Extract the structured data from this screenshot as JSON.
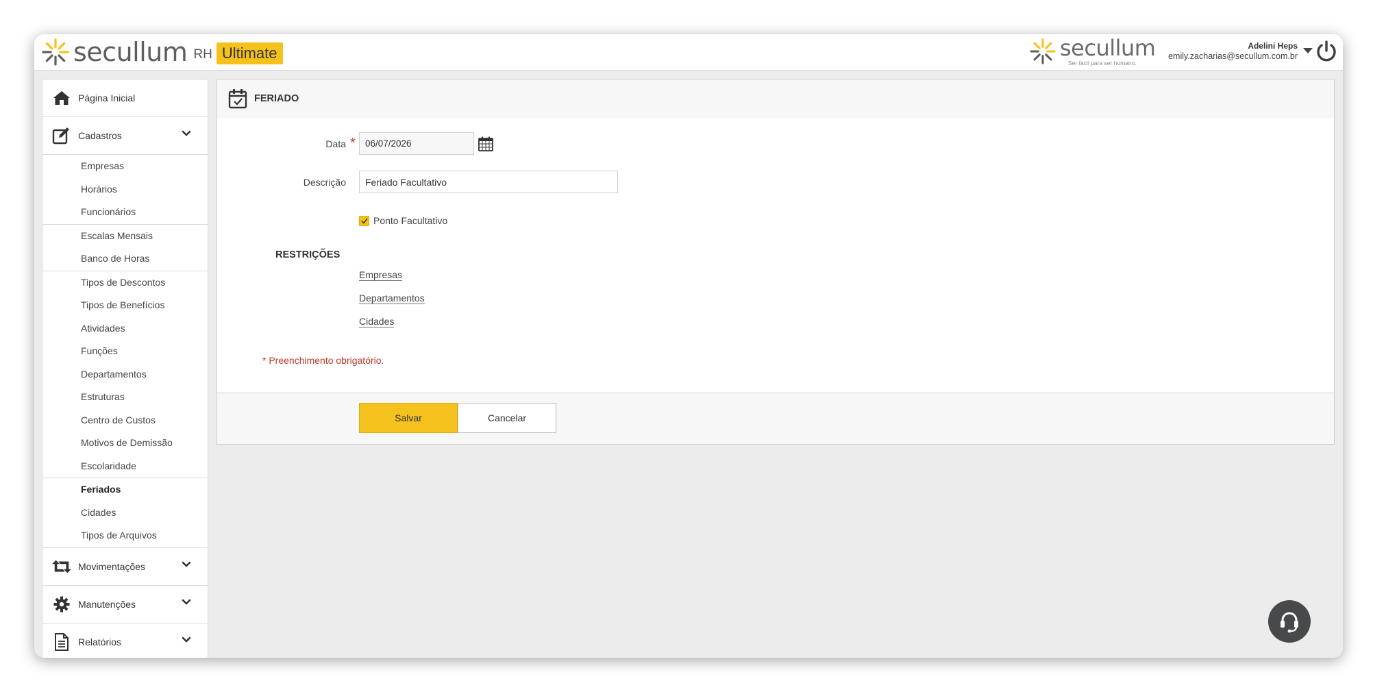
{
  "header": {
    "logo_word": "secullum",
    "logo_rh": "RH",
    "logo_badge": "Ultimate",
    "brand_word": "secullum",
    "brand_tagline": "Ser fácil para ser humano.",
    "user_name": "Adelini Heps",
    "user_email": "emily.zacharias@secullum.com.br"
  },
  "sidebar": {
    "home": "Página Inicial",
    "cadastros": "Cadastros",
    "groups": [
      [
        "Empresas",
        "Horários",
        "Funcionários"
      ],
      [
        "Escalas Mensais",
        "Banco de Horas"
      ],
      [
        "Tipos de Descontos",
        "Tipos de Benefícios",
        "Atividades",
        "Funções",
        "Departamentos",
        "Estruturas",
        "Centro de Custos",
        "Motivos de Demissão",
        "Escolaridade"
      ],
      [
        "Feriados",
        "Cidades",
        "Tipos de Arquivos"
      ]
    ],
    "active_item": "Feriados",
    "movimentacoes": "Movimentações",
    "manutencoes": "Manutenções",
    "relatorios": "Relatórios"
  },
  "form": {
    "title": "FERIADO",
    "date_label": "Data",
    "date_value": "06/07/2026",
    "description_label": "Descrição",
    "description_value": "Feriado Facultativo",
    "checkbox_label": "Ponto Facultativo",
    "checkbox_checked": true,
    "restrictions_title": "RESTRIÇÕES",
    "restrictions": [
      "Empresas",
      "Departamentos",
      "Cidades"
    ],
    "required_note": "* Preenchimento obrigatório.",
    "required_star": "*",
    "save_label": "Salvar",
    "cancel_label": "Cancelar"
  },
  "colors": {
    "accent": "#f5c11c",
    "required": "#c0392b",
    "help_button": "#47494a"
  }
}
